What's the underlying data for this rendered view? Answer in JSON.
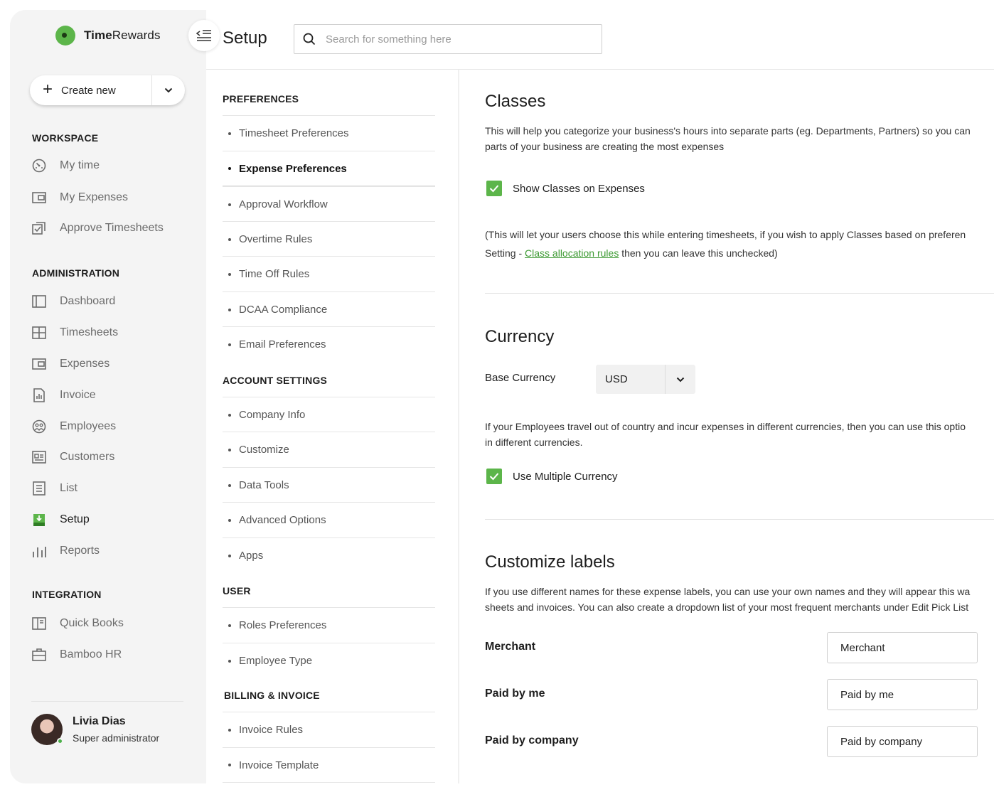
{
  "brand": {
    "name_bold": "Time",
    "name_rest": "Rewards"
  },
  "create_new": {
    "label": "Create new"
  },
  "sidebar": {
    "workspace_title": "WORKSPACE",
    "workspace": [
      {
        "label": "My time",
        "icon": "gauge-icon"
      },
      {
        "label": "My Expenses",
        "icon": "wallet-icon"
      },
      {
        "label": "Approve Timesheets",
        "icon": "approve-icon"
      }
    ],
    "administration_title": "ADMINISTRATION",
    "administration": [
      {
        "label": "Dashboard",
        "icon": "dashboard-icon"
      },
      {
        "label": "Timesheets",
        "icon": "grid-icon"
      },
      {
        "label": "Expenses",
        "icon": "wallet-icon"
      },
      {
        "label": "Invoice",
        "icon": "invoice-icon"
      },
      {
        "label": "Employees",
        "icon": "employees-icon"
      },
      {
        "label": "Customers",
        "icon": "customers-icon"
      },
      {
        "label": "List",
        "icon": "list-icon"
      },
      {
        "label": "Setup",
        "icon": "setup-icon",
        "active": true
      },
      {
        "label": "Reports",
        "icon": "reports-icon"
      }
    ],
    "integration_title": "INTEGRATION",
    "integration": [
      {
        "label": "Quick Books",
        "icon": "book-icon"
      },
      {
        "label": "Bamboo HR",
        "icon": "briefcase-icon"
      }
    ],
    "user": {
      "name": "Livia Dias",
      "role": "Super administrator"
    }
  },
  "header": {
    "title": "Setup",
    "search_placeholder": "Search for something here"
  },
  "settings_nav": {
    "preferences_title": "PREFERENCES",
    "preferences": [
      "Timesheet Preferences",
      "Expense Preferences",
      "Approval Workflow",
      "Overtime Rules",
      "Time Off Rules",
      "DCAA Compliance",
      "Email Preferences"
    ],
    "account_title": "ACCOUNT SETTINGS",
    "account": [
      "Company Info",
      "Customize",
      "Data Tools",
      "Advanced Options",
      "Apps"
    ],
    "user_title": "USER",
    "user": [
      "Roles Preferences",
      "Employee Type"
    ],
    "billing_title": "BILLING & INVOICE",
    "billing": [
      "Invoice Rules",
      "Invoice Template"
    ],
    "active": "Expense Preferences"
  },
  "classes": {
    "title": "Classes",
    "desc_line1": "This will help you categorize your business's hours into separate parts (eg. Departments, Partners) so you can",
    "desc_line2": "parts of your business are creating the most expenses",
    "checkbox_label": "Show Classes on Expenses",
    "note_line1": "(This will let your users choose this while entering timesheets, if you wish to apply Classes based on preferen",
    "note_prefix": "Setting - ",
    "note_link": "Class allocation rules",
    "note_suffix": " then you can leave this unchecked)"
  },
  "currency": {
    "title": "Currency",
    "base_label": "Base Currency",
    "base_value": "USD",
    "desc_line1": "If your Employees travel out of country and incur expenses in different currencies, then you can use this optio",
    "desc_line2": "in different currencies.",
    "checkbox_label": "Use Multiple Currency"
  },
  "labels": {
    "title": "Customize labels",
    "desc_line1": "If you use different names for these expense labels, you can use your own names and they will appear this wa",
    "desc_line2": "sheets and invoices. You can also create a dropdown list of your most frequent merchants under Edit Pick List",
    "rows": [
      {
        "label": "Merchant",
        "value": "Merchant"
      },
      {
        "label": "Paid by me",
        "value": "Paid by me"
      },
      {
        "label": "Paid by company",
        "value": "Paid by company"
      }
    ]
  },
  "colors": {
    "accent": "#5cb54a",
    "link": "#3d9a33",
    "sidebar_bg": "#f4f4f4"
  }
}
